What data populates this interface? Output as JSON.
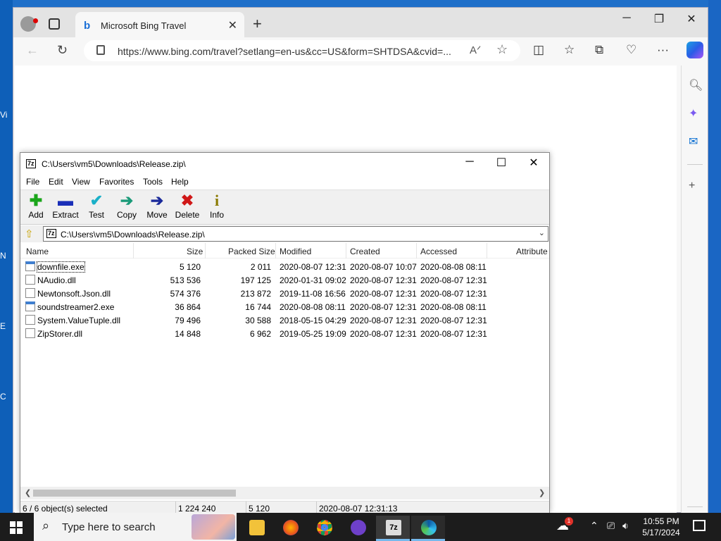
{
  "desktop": {
    "labels": [
      "Vi",
      "N",
      "E",
      "C"
    ]
  },
  "browser": {
    "tab_title": "Microsoft Bing Travel",
    "url": "https://www.bing.com/travel?setlang=en-us&cc=US&form=SHTDSA&cvid=...",
    "favicon": "b"
  },
  "zip": {
    "title": "C:\\Users\\vm5\\Downloads\\Release.zip\\",
    "menu": [
      "File",
      "Edit",
      "View",
      "Favorites",
      "Tools",
      "Help"
    ],
    "toolbar": [
      {
        "label": "Add",
        "icon": "plus-icon",
        "glyph": "✚",
        "color": "#1aa51a"
      },
      {
        "label": "Extract",
        "icon": "minus-icon",
        "glyph": "▬",
        "color": "#1a2fb8"
      },
      {
        "label": "Test",
        "icon": "check-icon",
        "glyph": "✔",
        "color": "#1ab0c8"
      },
      {
        "label": "Copy",
        "icon": "copy-arrow-icon",
        "glyph": "➔",
        "color": "#1a9a78"
      },
      {
        "label": "Move",
        "icon": "move-arrow-icon",
        "glyph": "➔",
        "color": "#1a2a9a"
      },
      {
        "label": "Delete",
        "icon": "delete-x-icon",
        "glyph": "✖",
        "color": "#d01818"
      },
      {
        "label": "Info",
        "icon": "info-icon",
        "glyph": "i",
        "color": "#8a7a00"
      }
    ],
    "path": "C:\\Users\\vm5\\Downloads\\Release.zip\\",
    "columns": [
      "Name",
      "Size",
      "Packed Size",
      "Modified",
      "Created",
      "Accessed",
      "Attribute"
    ],
    "files": [
      {
        "name": "downfile.exe",
        "type": "exe",
        "size": "5 120",
        "packed": "2 011",
        "modified": "2020-08-07 12:31",
        "created": "2020-08-07 10:07",
        "accessed": "2020-08-08 08:11"
      },
      {
        "name": "NAudio.dll",
        "type": "dll",
        "size": "513 536",
        "packed": "197 125",
        "modified": "2020-01-31 09:02",
        "created": "2020-08-07 12:31",
        "accessed": "2020-08-07 12:31"
      },
      {
        "name": "Newtonsoft.Json.dll",
        "type": "dll",
        "size": "574 376",
        "packed": "213 872",
        "modified": "2019-11-08 16:56",
        "created": "2020-08-07 12:31",
        "accessed": "2020-08-07 12:31"
      },
      {
        "name": "soundstreamer2.exe",
        "type": "exe",
        "size": "36 864",
        "packed": "16 744",
        "modified": "2020-08-08 08:11",
        "created": "2020-08-07 12:31",
        "accessed": "2020-08-08 08:11"
      },
      {
        "name": "System.ValueTuple.dll",
        "type": "dll",
        "size": "79 496",
        "packed": "30 588",
        "modified": "2018-05-15 04:29",
        "created": "2020-08-07 12:31",
        "accessed": "2020-08-07 12:31"
      },
      {
        "name": "ZipStorer.dll",
        "type": "dll",
        "size": "14 848",
        "packed": "6 962",
        "modified": "2019-05-25 19:09",
        "created": "2020-08-07 12:31",
        "accessed": "2020-08-07 12:31"
      }
    ],
    "status": {
      "selection": "6 / 6 object(s) selected",
      "total_size": "1 224 240",
      "selected_size": "5 120",
      "date": "2020-08-07 12:31:13"
    }
  },
  "taskbar": {
    "search_placeholder": "Type here to search",
    "weather_badge": "1",
    "time": "10:55 PM",
    "date": "5/17/2024"
  }
}
